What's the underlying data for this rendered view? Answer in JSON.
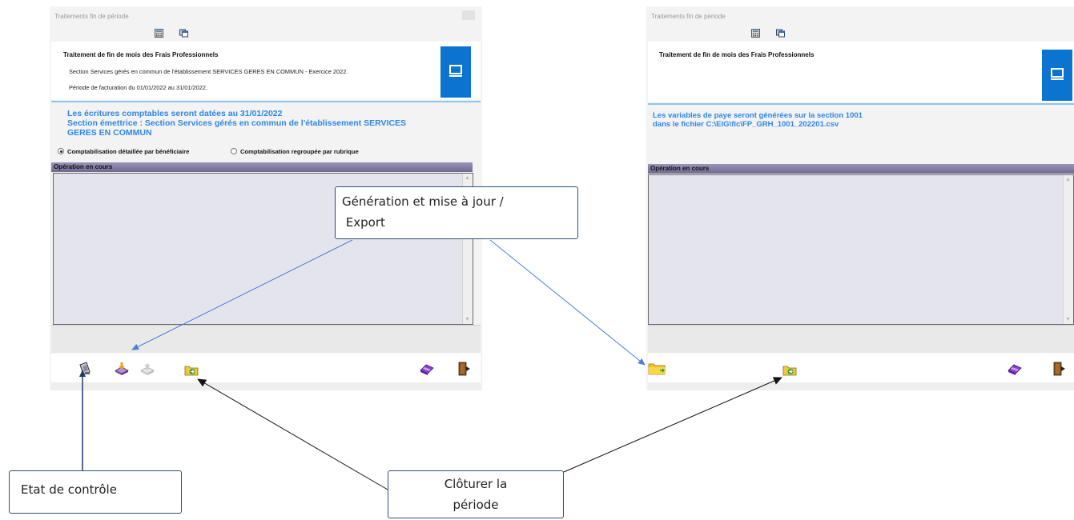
{
  "left_window": {
    "title": "Traitements fin de période",
    "header_title": "Traitement de fin de mois des Frais Professionnels",
    "header_line1": "Section Services gérés en commun de l'établissement SERVICES GERES EN COMMUN - Exercice 2022.",
    "header_line2": "Période de facturation du 01/01/2022 au 31/01/2022.",
    "info_line1": "Les écritures comptables seront datées au 31/01/2022",
    "info_line2": "Section émettrice : Section Services gérés en commun de l'établissement SERVICES",
    "info_line3": "GERES EN COMMUN",
    "radio_option1": "Comptabilisation détaillée par bénéficiaire",
    "radio_option2": "Comptabilisation regroupée par rubrique",
    "radio_selected": "Comptabilisation détaillée par bénéficiaire",
    "operation_header": "Opération en cours"
  },
  "right_window": {
    "title": "Traitements fin de période",
    "header_title": "Traitement de fin de mois des Frais Professionnels",
    "info_line1": "Les variables de paye seront générées sur la section 1001",
    "info_line2": "dans le fichier C:\\EIG\\fic\\FP_GRH_1001_202201.csv",
    "operation_header": "Opération en cours"
  },
  "annotations": {
    "generation": {
      "line1": "Génération et mise à jour /",
      "line2": " Export"
    },
    "etat": "Etat de contrôle",
    "cloturer": {
      "line1": "Clôturer la",
      "line2": "période"
    }
  },
  "icons": {
    "toolbar_top": [
      "calculator-icon",
      "window-icon"
    ],
    "header_badge": "computer-icon",
    "left_tools": [
      "control-report-icon",
      "generate-icon",
      "export-icon",
      "close-period-icon",
      "eraser-icon",
      "exit-door-icon"
    ],
    "right_tools": [
      "export-folder-icon",
      "close-period-icon",
      "eraser-icon",
      "exit-door-icon"
    ]
  },
  "colors": {
    "info_blue": "#2e86e6",
    "badge_blue": "#0a74d0",
    "operation_header": "#7b74a0",
    "callout_border": "#2f4f7a",
    "arrow_blue": "#4a7fd4",
    "arrow_black": "#111111"
  }
}
